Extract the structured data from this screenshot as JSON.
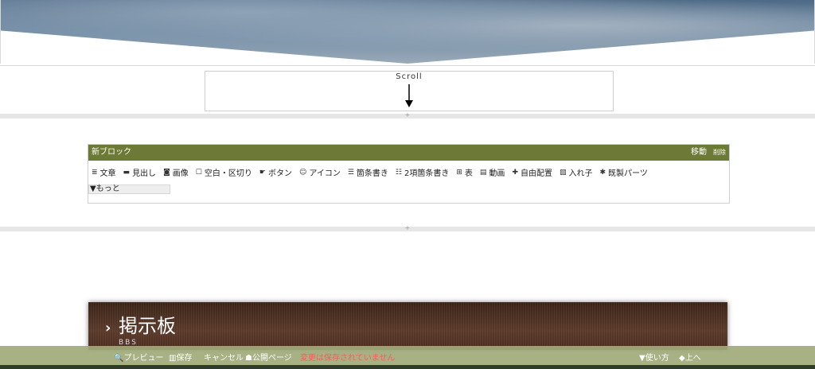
{
  "scroll": {
    "label": "Scroll"
  },
  "block": {
    "title": "新ブロック",
    "move_label": "移動",
    "delete_label": "削除",
    "tools": [
      {
        "icon": "≣",
        "label": "文章"
      },
      {
        "icon": "▬",
        "label": "見出し"
      },
      {
        "icon": "◙",
        "label": "画像"
      },
      {
        "icon": "☐",
        "label": "空白・区切り"
      },
      {
        "icon": "☛",
        "label": "ボタン"
      },
      {
        "icon": "☺",
        "label": "アイコン"
      },
      {
        "icon": "☰",
        "label": "箇条書き"
      },
      {
        "icon": "☷",
        "label": "2項箇条書き"
      },
      {
        "icon": "⊞",
        "label": "表"
      },
      {
        "icon": "▤",
        "label": "動画"
      },
      {
        "icon": "✚",
        "label": "自由配置"
      },
      {
        "icon": "▧",
        "label": "入れ子"
      },
      {
        "icon": "✱",
        "label": "既製パーツ"
      }
    ],
    "more_label": "▼もっと"
  },
  "bbs": {
    "chevron": "›",
    "title": "掲示板",
    "subtitle": "BBS"
  },
  "bottombar": {
    "preview": "🔍プレビュー",
    "save": "▥保存",
    "cancel": "キャンセル",
    "public_page": "☗公開ページ",
    "warning": "変更は保存されていません",
    "howto": "▼使い方",
    "up": "◆上へ"
  },
  "colors": {
    "block_header": "#6b7a35",
    "bottombar": "#a0aa78",
    "warning": "#ff5a5a",
    "bbs_bg": "#4a2d20"
  }
}
